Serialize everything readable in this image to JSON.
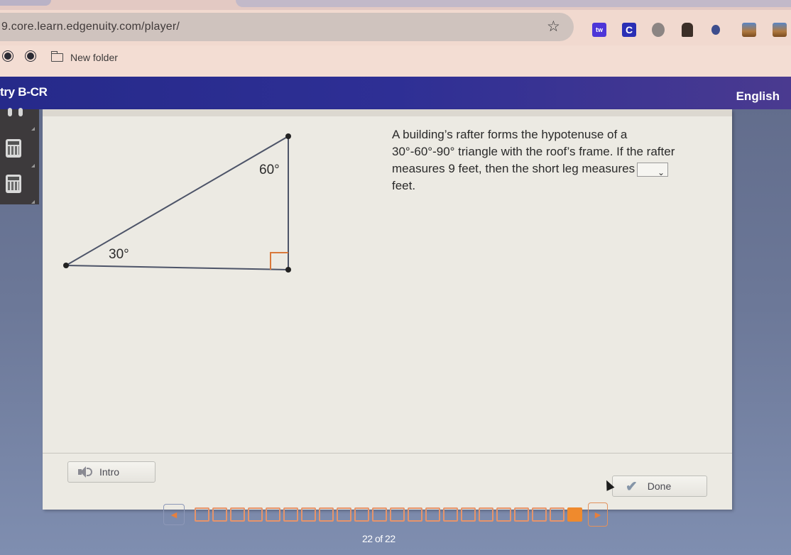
{
  "browser": {
    "url": "9.core.learn.edgenuity.com/player/",
    "bookmark_star": "☆",
    "extensions": [
      "tw-puzzle-extension-icon",
      "c-extension-icon",
      "gray-extension-icon",
      "house-extension-icon",
      "bug-extension-icon",
      "image-extension-icon",
      "image-extension-icon"
    ],
    "extension_labels": {
      "tw": "tw",
      "c": "C"
    },
    "bookmarks": [
      {
        "type": "globe"
      },
      {
        "type": "globe"
      },
      {
        "type": "folder",
        "label": "New folder"
      }
    ]
  },
  "app": {
    "title": "try B-CR",
    "language": "English",
    "accent_color": "#2e2f95"
  },
  "side_tools": [
    "headphones-icon",
    "calculator-icon",
    "calculator-icon"
  ],
  "question": {
    "line1": "A building’s rafter forms the hypotenuse of a",
    "line2": "30°-60°-90° triangle with the roof’s frame. If the rafter",
    "line3": "measures 9 feet, then the short leg measures",
    "line4": "feet.",
    "answer_dropdown": {
      "selected": "",
      "chevron": "⌄"
    }
  },
  "figure": {
    "angle_top": "60°",
    "angle_left": "30°",
    "right_angle_marker_color": "#d9783a"
  },
  "buttons": {
    "intro": "Intro",
    "done": "Done",
    "done_check": "✔"
  },
  "pagination": {
    "total": 22,
    "current": 22,
    "prev_icon": "◀",
    "next_icon": "▶",
    "label": "22 of 22",
    "color": "#ef8a2d"
  }
}
